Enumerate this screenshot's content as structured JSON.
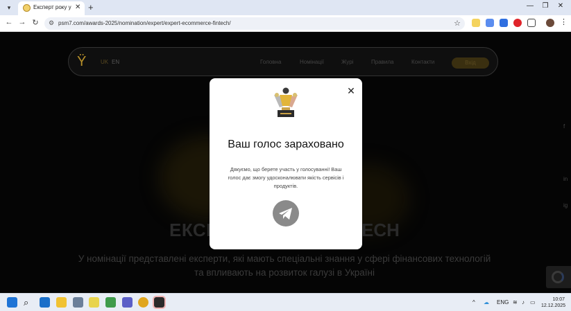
{
  "browser": {
    "tab_title": "Експерт року у FinT",
    "url": "psm7.com/awards-2025/nomination/expert/expert-ecommerce-fintech/",
    "extensions": [
      {
        "name": "ext-1-icon",
        "color": "#f4d35e"
      },
      {
        "name": "ext-2-icon",
        "color": "#5b8def"
      },
      {
        "name": "translate-icon",
        "color": "#2f6fe0"
      },
      {
        "name": "opera-icon",
        "color": "#e0242a"
      }
    ]
  },
  "site": {
    "lang_uk": "UK",
    "lang_en": "EN",
    "nav": [
      "Головна",
      "Номінації",
      "Журі",
      "Правила",
      "Контакти"
    ],
    "login": "Вхід",
    "hero_title_left": "ЕКСП",
    "hero_title_right": "ECH",
    "hero_text": "У номінації представлені експерти, які мають спеціальні знання у сфері фінансових технологій та впливають на розвиток галузі в Україні",
    "social": [
      "f",
      "in",
      "ig"
    ]
  },
  "modal": {
    "title": "Ваш голос зараховано",
    "text": "Дякуємо, що берете участь у голосуванні! Ваш голос дає змогу удосконалювати якість сервісів і продуктів."
  },
  "taskbar": {
    "lang": "ENG",
    "time": "10:07",
    "date": "12.12.2025"
  },
  "colors": {
    "page_bg": "#050505",
    "accent_gold": "#b8912a",
    "modal_bg": "#ffffff"
  }
}
